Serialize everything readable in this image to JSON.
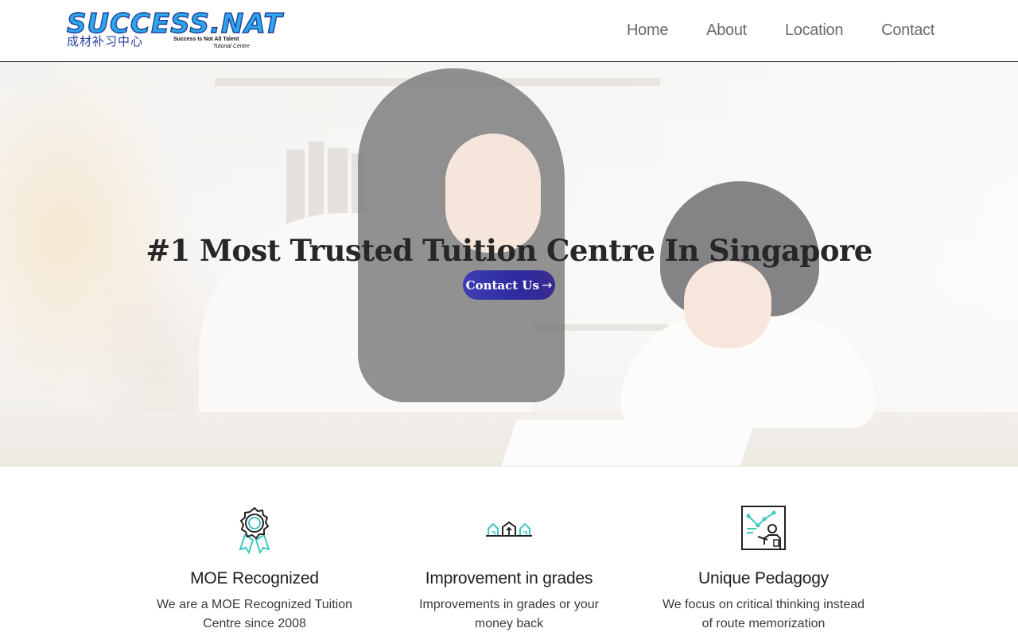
{
  "header": {
    "logo": {
      "brand": "SUCCESS.NAT",
      "chinese": "成材补习中心",
      "tagline": "Success Is Not All Talent",
      "subtitle": "Tutorial Centre"
    },
    "nav": [
      {
        "label": "Home"
      },
      {
        "label": "About"
      },
      {
        "label": "Location"
      },
      {
        "label": "Contact"
      }
    ]
  },
  "hero": {
    "title": "#1 Most Trusted Tuition Centre In Singapore",
    "cta_label": "Contact Us",
    "cta_icon": "arrow-right-icon"
  },
  "features": [
    {
      "icon": "award-ribbon-icon",
      "title": "MOE Recognized",
      "description": "We are a MOE Recognized Tuition Centre since 2008"
    },
    {
      "icon": "houses-growth-icon",
      "title": "Improvement in grades",
      "description": "Improvements in grades or your money back"
    },
    {
      "icon": "teacher-board-icon",
      "title": "Unique Pedagogy",
      "description": "We focus on critical thinking instead of route memorization"
    }
  ],
  "colors": {
    "accent": "#3c3fb3",
    "icon_teal": "#3cc8c0",
    "nav_text": "#6b6b6b"
  }
}
